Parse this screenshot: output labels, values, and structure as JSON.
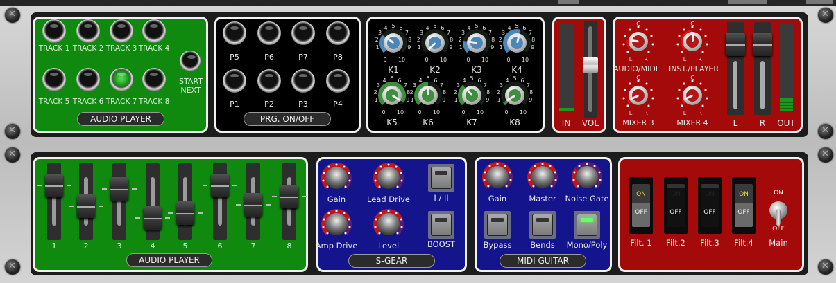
{
  "rack1": {
    "audio_player": {
      "title": "AUDIO PLAYER",
      "tracks": [
        {
          "label": "TRACK 1",
          "active": false
        },
        {
          "label": "TRACK 2",
          "active": false
        },
        {
          "label": "TRACK 3",
          "active": false
        },
        {
          "label": "TRACK 4",
          "active": false
        },
        {
          "label": "TRACK 5",
          "active": false
        },
        {
          "label": "TRACK 6",
          "active": false
        },
        {
          "label": "TRACK 7",
          "active": true
        },
        {
          "label": "TRACK 8",
          "active": false
        }
      ],
      "start_next": {
        "line1": "START",
        "line2": "NEXT"
      }
    },
    "program": {
      "title": "PRG. ON/OFF",
      "buttons": [
        "P5",
        "P6",
        "P7",
        "P8",
        "P1",
        "P2",
        "P3",
        "P4"
      ]
    },
    "knobs": {
      "scale": [
        "0",
        "1",
        "2",
        "3",
        "4",
        "5",
        "6",
        "7",
        "8",
        "9",
        "10"
      ],
      "items": [
        {
          "label": "K1",
          "value": 3,
          "color": "#4a86b8"
        },
        {
          "label": "K2",
          "value": 0,
          "color": "#4a86b8"
        },
        {
          "label": "K3",
          "value": 2,
          "color": "#4a86b8"
        },
        {
          "label": "K4",
          "value": 5.5,
          "color": "#4a86b8"
        },
        {
          "label": "K5",
          "value": 9.5,
          "color": "#3d8f3d"
        },
        {
          "label": "K6",
          "value": 5,
          "color": "#3d8f3d"
        },
        {
          "label": "K7",
          "value": 3.5,
          "color": "#3d8f3d"
        },
        {
          "label": "K8",
          "value": 0.5,
          "color": "#3d8f3d"
        }
      ]
    },
    "io": {
      "in_label": "IN",
      "vol_label": "VOL",
      "in_level": 0.03,
      "vol_level": 0.55
    },
    "mixer": {
      "center": "C",
      "left": "L",
      "right": "R",
      "pans": [
        {
          "label": "AUDIO/MIDI",
          "pan": -0.6
        },
        {
          "label": "INST./PLAYER",
          "pan": 0
        },
        {
          "label": "MIXER 3",
          "pan": -0.85
        },
        {
          "label": "MIXER 4",
          "pan": -0.85
        }
      ],
      "l_label": "L",
      "r_label": "R",
      "out_label": "OUT",
      "l_level": 0.85,
      "r_level": 0.85,
      "out_level": 0.15
    }
  },
  "rack2": {
    "audio_player": {
      "title": "AUDIO PLAYER",
      "faders": [
        {
          "label": "1",
          "level": 0.8
        },
        {
          "label": "2",
          "level": 0.42
        },
        {
          "label": "3",
          "level": 0.74
        },
        {
          "label": "4",
          "level": 0.2
        },
        {
          "label": "5",
          "level": 0.28
        },
        {
          "label": "6",
          "level": 0.8
        },
        {
          "label": "7",
          "level": 0.44
        },
        {
          "label": "8",
          "level": 0.6
        }
      ]
    },
    "sgear": {
      "title": "S-GEAR",
      "knobs": [
        {
          "label": "Gain",
          "value": 0.75
        },
        {
          "label": "Lead Drive",
          "value": 0.75
        },
        {
          "label": "Amp Drive",
          "value": 0.75
        },
        {
          "label": "Level",
          "value": 0.75
        }
      ],
      "buttons": [
        {
          "label": "I / II",
          "lit": false
        },
        {
          "label": "BOOST",
          "lit": false
        }
      ]
    },
    "midi_guitar": {
      "title": "MIDI GUITAR",
      "knobs": [
        {
          "label": "Gain",
          "value": 0.75
        },
        {
          "label": "Master",
          "value": 0.75
        },
        {
          "label": "Noise Gate",
          "value": 0.3
        }
      ],
      "buttons": [
        {
          "label": "Bypass",
          "lit": false
        },
        {
          "label": "Bends",
          "lit": false
        },
        {
          "label": "Mono/Poly",
          "lit": true
        }
      ]
    },
    "filters": {
      "on_text": "ON",
      "off_text": "OFF",
      "switches": [
        {
          "label": "Filt. 1",
          "on": true
        },
        {
          "label": "Filt.2",
          "on": false
        },
        {
          "label": "Filt.3",
          "on": false
        },
        {
          "label": "Filt.4",
          "on": true
        }
      ],
      "main": {
        "label": "Main",
        "on_text": "ON",
        "off_text": "OFF",
        "on": false
      }
    }
  },
  "colors": {
    "green": "#0f8a0f",
    "black": "#000000",
    "red": "#a50a0a",
    "blue": "#14148c"
  }
}
